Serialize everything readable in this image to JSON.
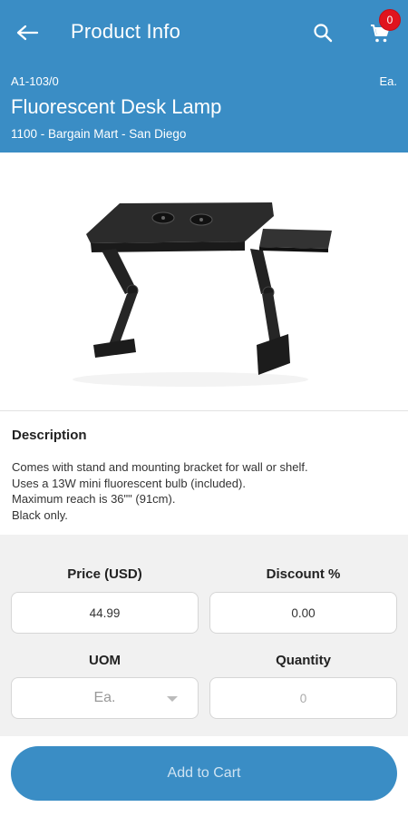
{
  "appbar": {
    "title": "Product Info",
    "cart_count": "0",
    "icons": {
      "back": "back-arrow-icon",
      "search": "search-icon",
      "cart": "cart-icon"
    }
  },
  "product": {
    "sku": "A1-103/0",
    "unit": "Ea.",
    "name": "Fluorescent Desk Lamp",
    "store": "1100 - Bargain Mart - San Diego"
  },
  "description": {
    "heading": "Description",
    "lines": [
      "Comes with stand and mounting bracket for wall or shelf.",
      "Uses a 13W mini fluorescent bulb (included).",
      "Maximum reach is 36\"\" (91cm).",
      "Black only."
    ]
  },
  "form": {
    "price_label": "Price (USD)",
    "price_value": "44.99",
    "discount_label": "Discount %",
    "discount_value": "0.00",
    "uom_label": "UOM",
    "uom_value": "Ea.",
    "quantity_label": "Quantity",
    "quantity_placeholder": "0"
  },
  "footer": {
    "add_to_cart": "Add to Cart"
  },
  "colors": {
    "primary": "#3a8dc5",
    "badge": "#e0141e",
    "panel_bg": "#f1f1f1"
  }
}
